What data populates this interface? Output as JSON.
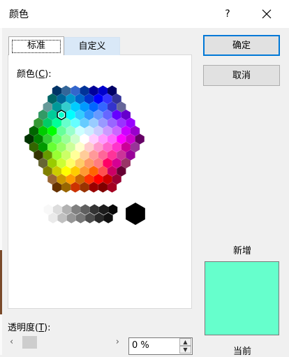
{
  "window": {
    "title": "颜色",
    "help": "?",
    "close": "✕"
  },
  "tabs": {
    "standard": "标准",
    "custom": "自定义"
  },
  "colors_label": {
    "text": "颜色(",
    "hotkey": "C",
    "end": "):"
  },
  "buttons": {
    "ok": "确定",
    "cancel": "取消"
  },
  "preview": {
    "new_label": "新增",
    "current_label": "当前",
    "new_color": "#66ffcc"
  },
  "transparency": {
    "label": "透明度(",
    "hotkey": "T",
    "end": "):",
    "value": "0 %",
    "left_arrow": "‹",
    "right_arrow": "›"
  },
  "selected_color": "#00ffcc",
  "hex_colors": {
    "rows": [
      [
        "#003366",
        "#336699",
        "#3366cc",
        "#003399",
        "#000099",
        "#0000cc",
        "#000066"
      ],
      [
        "#006666",
        "#006699",
        "#0099cc",
        "#0066cc",
        "#0033cc",
        "#0000ff",
        "#3333ff",
        "#333399"
      ],
      [
        "#669999",
        "#009999",
        "#33cccc",
        "#00ccff",
        "#0099ff",
        "#0066ff",
        "#3366ff",
        "#3333cc",
        "#666699"
      ],
      [
        "#339966",
        "#00cc99",
        "#00ffcc",
        "#00ffff",
        "#33ccff",
        "#3399ff",
        "#6699ff",
        "#6666ff",
        "#6600ff",
        "#6600cc"
      ],
      [
        "#339933",
        "#00cc66",
        "#00ff99",
        "#66ffcc",
        "#66ffff",
        "#66ccff",
        "#99ccff",
        "#9999ff",
        "#9966ff",
        "#9933ff",
        "#9900ff"
      ],
      [
        "#006600",
        "#00cc00",
        "#00ff00",
        "#66ff99",
        "#99ffcc",
        "#ccffff",
        "#ccecff",
        "#ccccff",
        "#cc99ff",
        "#cc66ff",
        "#cc00ff",
        "#9900cc"
      ],
      [
        "#003300",
        "#008000",
        "#33cc33",
        "#66ff66",
        "#99ff99",
        "#ccffcc",
        "#ffffff",
        "#ffccff",
        "#ff99ff",
        "#ff66ff",
        "#ff00ff",
        "#cc00cc",
        "#660066"
      ],
      [
        "#336600",
        "#009900",
        "#66ff33",
        "#99ff66",
        "#ccff99",
        "#ffffcc",
        "#ffcccc",
        "#ff99cc",
        "#ff66cc",
        "#ff33cc",
        "#cc0099",
        "#993399"
      ],
      [
        "#333300",
        "#669900",
        "#99ff33",
        "#ccff66",
        "#ffff99",
        "#ffcc99",
        "#ff9999",
        "#ff6699",
        "#ff3399",
        "#cc3399",
        "#990099"
      ],
      [
        "#666633",
        "#99cc00",
        "#ccff33",
        "#ffff66",
        "#ffcc66",
        "#ff9966",
        "#ff7c80",
        "#ff0066",
        "#d60093",
        "#993366"
      ],
      [
        "#808000",
        "#cccc00",
        "#ffff00",
        "#ffcc00",
        "#ff9933",
        "#ff6600",
        "#ff5050",
        "#cc0066",
        "#660033"
      ],
      [
        "#996633",
        "#cc9900",
        "#ff9900",
        "#cc6600",
        "#ff3300",
        "#ff0000",
        "#cc0000",
        "#990033"
      ],
      [
        "#663300",
        "#996600",
        "#cc3300",
        "#993300",
        "#990000",
        "#800000",
        "#a50021"
      ]
    ],
    "grays_top": [
      "#f8f8f8",
      "#dddddd",
      "#b2b2b2",
      "#808080",
      "#5f5f5f",
      "#333333",
      "#1c1c1c",
      "#080808"
    ],
    "grays_bottom": [
      "#eaeaea",
      "#c0c0c0",
      "#969696",
      "#777777",
      "#4d4d4d",
      "#292929",
      "#111111"
    ],
    "big": "#000000"
  }
}
